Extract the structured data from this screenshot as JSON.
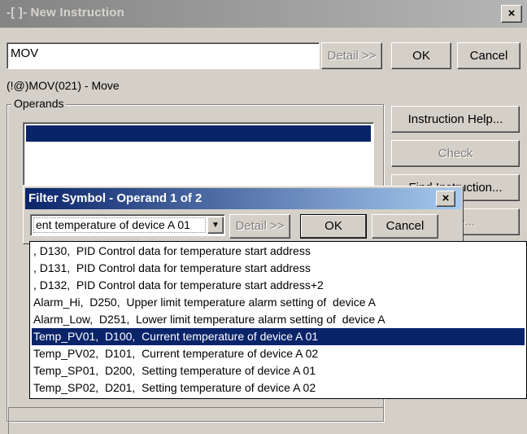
{
  "main_window": {
    "title": "-[ ]- New Instruction",
    "close_glyph": "×",
    "instruction_value": "MOV",
    "detail_button": "Detail >>",
    "ok_button": "OK",
    "cancel_button": "Cancel",
    "instruction_desc": "(!@)MOV(021) - Move",
    "operands_label": "Operands",
    "right_buttons": [
      {
        "label": "Instruction Help..."
      },
      {
        "label": "Check"
      },
      {
        "label": "Find Instruction..."
      },
      {
        "label": "Table..."
      }
    ]
  },
  "filter_dialog": {
    "title": "Filter Symbol - Operand 1 of 2",
    "close_glyph": "×",
    "combo_value": "ent temperature of device A 01",
    "dropdown_arrow": "▼",
    "detail_button": "Detail >>",
    "ok_button": "OK",
    "cancel_button": "Cancel"
  },
  "dropdown_items": [
    {
      "text": ", D130,  PID Control data for temperature start address",
      "selected": false
    },
    {
      "text": ", D131,  PID Control data for temperature start address",
      "selected": false
    },
    {
      "text": ", D132,  PID Control data for temperature start address+2",
      "selected": false
    },
    {
      "text": "Alarm_Hi,  D250,  Upper limit temperature alarm setting of  device A",
      "selected": false
    },
    {
      "text": "Alarm_Low,  D251,  Lower limit temperature alarm setting of  device A",
      "selected": false
    },
    {
      "text": "Temp_PV01,  D100,  Current temperature of device A 01",
      "selected": true
    },
    {
      "text": "Temp_PV02,  D101,  Current temperature of device A 02",
      "selected": false
    },
    {
      "text": "Temp_SP01,  D200,  Setting temperature of device A 01",
      "selected": false
    },
    {
      "text": "Temp_SP02,  D201,  Setting temperature of device A 02",
      "selected": false
    }
  ]
}
